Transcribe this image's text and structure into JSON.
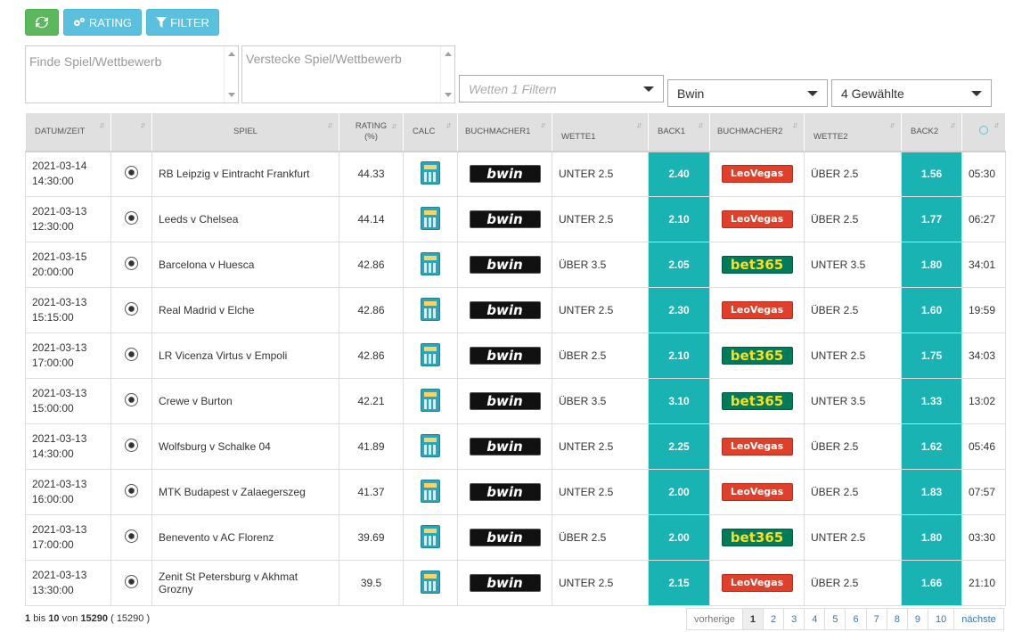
{
  "toolbar": {
    "refresh_icon": "refresh-icon",
    "rating_label": "RATING",
    "filter_label": "FILTER"
  },
  "filters": {
    "find_placeholder": "Finde Spiel/Wettbewerb",
    "hide_placeholder": "Verstecke Spiel/Wettbewerb",
    "bet_filter_placeholder": "Wetten 1 Filtern",
    "bookmaker_value": "Bwin",
    "selected_value": "4 Gewählte"
  },
  "table": {
    "headers": [
      "DATUM/ZEIT",
      "",
      "SPIEL",
      "RATING (%)",
      "CALC",
      "BUCHMACHER1",
      "WETTE1",
      "BACK1",
      "BUCHMACHER2",
      "WETTE2",
      "BACK2",
      ""
    ],
    "rows": [
      {
        "date": "2021-03-14",
        "time": "14:30:00",
        "match": "RB Leipzig v Eintracht Frankfurt",
        "rating": "44.33",
        "bm1": "bwin",
        "bet1": "UNTER 2.5",
        "back1": "2.40",
        "bm2": "LeoVegas",
        "bet2": "ÜBER 2.5",
        "back2": "1.56",
        "countdown": "05:30"
      },
      {
        "date": "2021-03-13",
        "time": "12:30:00",
        "match": "Leeds v Chelsea",
        "rating": "44.14",
        "bm1": "bwin",
        "bet1": "UNTER 2.5",
        "back1": "2.10",
        "bm2": "LeoVegas",
        "bet2": "ÜBER 2.5",
        "back2": "1.77",
        "countdown": "06:27"
      },
      {
        "date": "2021-03-15",
        "time": "20:00:00",
        "match": "Barcelona v Huesca",
        "rating": "42.86",
        "bm1": "bwin",
        "bet1": "ÜBER 3.5",
        "back1": "2.05",
        "bm2": "bet365",
        "bet2": "UNTER 3.5",
        "back2": "1.80",
        "countdown": "34:01"
      },
      {
        "date": "2021-03-13",
        "time": "15:15:00",
        "match": "Real Madrid v Elche",
        "rating": "42.86",
        "bm1": "bwin",
        "bet1": "UNTER 2.5",
        "back1": "2.30",
        "bm2": "LeoVegas",
        "bet2": "ÜBER 2.5",
        "back2": "1.60",
        "countdown": "19:59"
      },
      {
        "date": "2021-03-13",
        "time": "17:00:00",
        "match": "LR Vicenza Virtus v Empoli",
        "rating": "42.86",
        "bm1": "bwin",
        "bet1": "ÜBER 2.5",
        "back1": "2.10",
        "bm2": "bet365",
        "bet2": "UNTER 2.5",
        "back2": "1.75",
        "countdown": "34:03"
      },
      {
        "date": "2021-03-13",
        "time": "15:00:00",
        "match": "Crewe v Burton",
        "rating": "42.21",
        "bm1": "bwin",
        "bet1": "ÜBER 3.5",
        "back1": "3.10",
        "bm2": "bet365",
        "bet2": "UNTER 3.5",
        "back2": "1.33",
        "countdown": "13:02"
      },
      {
        "date": "2021-03-13",
        "time": "14:30:00",
        "match": "Wolfsburg v Schalke 04",
        "rating": "41.89",
        "bm1": "bwin",
        "bet1": "UNTER 2.5",
        "back1": "2.25",
        "bm2": "LeoVegas",
        "bet2": "ÜBER 2.5",
        "back2": "1.62",
        "countdown": "05:46"
      },
      {
        "date": "2021-03-13",
        "time": "16:00:00",
        "match": "MTK Budapest v Zalaegerszeg",
        "rating": "41.37",
        "bm1": "bwin",
        "bet1": "UNTER 2.5",
        "back1": "2.00",
        "bm2": "LeoVegas",
        "bet2": "ÜBER 2.5",
        "back2": "1.83",
        "countdown": "07:57"
      },
      {
        "date": "2021-03-13",
        "time": "17:00:00",
        "match": "Benevento v AC Florenz",
        "rating": "39.69",
        "bm1": "bwin",
        "bet1": "ÜBER 2.5",
        "back1": "2.00",
        "bm2": "bet365",
        "bet2": "UNTER 2.5",
        "back2": "1.80",
        "countdown": "03:30"
      },
      {
        "date": "2021-03-13",
        "time": "13:30:00",
        "match": "Zenit St Petersburg v Akhmat Grozny",
        "rating": "39.5",
        "bm1": "bwin",
        "bet1": "UNTER 2.5",
        "back1": "2.15",
        "bm2": "LeoVegas",
        "bet2": "ÜBER 2.5",
        "back2": "1.66",
        "countdown": "21:10"
      }
    ]
  },
  "footer": {
    "range_from": "1",
    "range_bis": "bis",
    "range_to": "10",
    "range_von": "von",
    "total": "15290",
    "total_paren": "( 15290 )",
    "prev_label": "vorherige",
    "next_label": "nächste",
    "pages": [
      "1",
      "2",
      "3",
      "4",
      "5",
      "6",
      "7",
      "8",
      "9",
      "10"
    ]
  },
  "colors": {
    "back_cell": "#19b3b4",
    "refresh_button": "#5cb85c",
    "action_button": "#5bc0de"
  }
}
